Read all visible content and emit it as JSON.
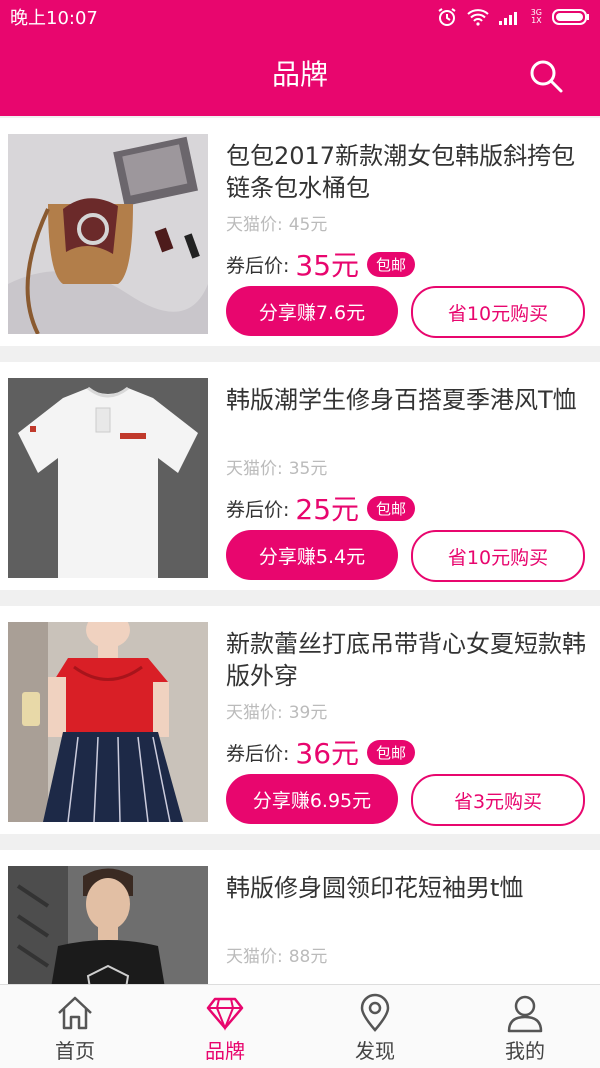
{
  "status_bar": {
    "time": "晚上10:07",
    "network_top": "3G",
    "network_bottom": "1X"
  },
  "header": {
    "title": "品牌"
  },
  "colors": {
    "brand": "#e8066e"
  },
  "products": [
    {
      "title": "包包2017新款潮女包韩版斜挎包链条包水桶包",
      "tmall_label": "天猫价:",
      "tmall_price": "45元",
      "coupon_label": "券后价:",
      "coupon_price": "35元",
      "badge": "包邮",
      "share_label": "分享赚7.6元",
      "buy_label": "省10元购买",
      "image": "bag-photo"
    },
    {
      "title": "韩版潮学生修身百搭夏季港风T恤",
      "tmall_label": "天猫价:",
      "tmall_price": "35元",
      "coupon_label": "券后价:",
      "coupon_price": "25元",
      "badge": "包邮",
      "share_label": "分享赚5.4元",
      "buy_label": "省10元购买",
      "image": "tshirt-photo"
    },
    {
      "title": "新款蕾丝打底吊带背心女夏短款韩版外穿",
      "tmall_label": "天猫价:",
      "tmall_price": "39元",
      "coupon_label": "券后价:",
      "coupon_price": "36元",
      "badge": "包邮",
      "share_label": "分享赚6.95元",
      "buy_label": "省3元购买",
      "image": "lace-top-photo"
    },
    {
      "title": "韩版修身圆领印花短袖男t恤",
      "tmall_label": "天猫价:",
      "tmall_price": "88元",
      "coupon_label": "券后价:",
      "coupon_price": "",
      "badge": "",
      "share_label": "",
      "buy_label": "",
      "image": "mens-tshirt-photo"
    }
  ],
  "tabs": [
    {
      "label": "首页",
      "icon": "home-icon",
      "active": false
    },
    {
      "label": "品牌",
      "icon": "diamond-icon",
      "active": true
    },
    {
      "label": "发现",
      "icon": "location-pin-icon",
      "active": false
    },
    {
      "label": "我的",
      "icon": "user-icon",
      "active": false
    }
  ]
}
